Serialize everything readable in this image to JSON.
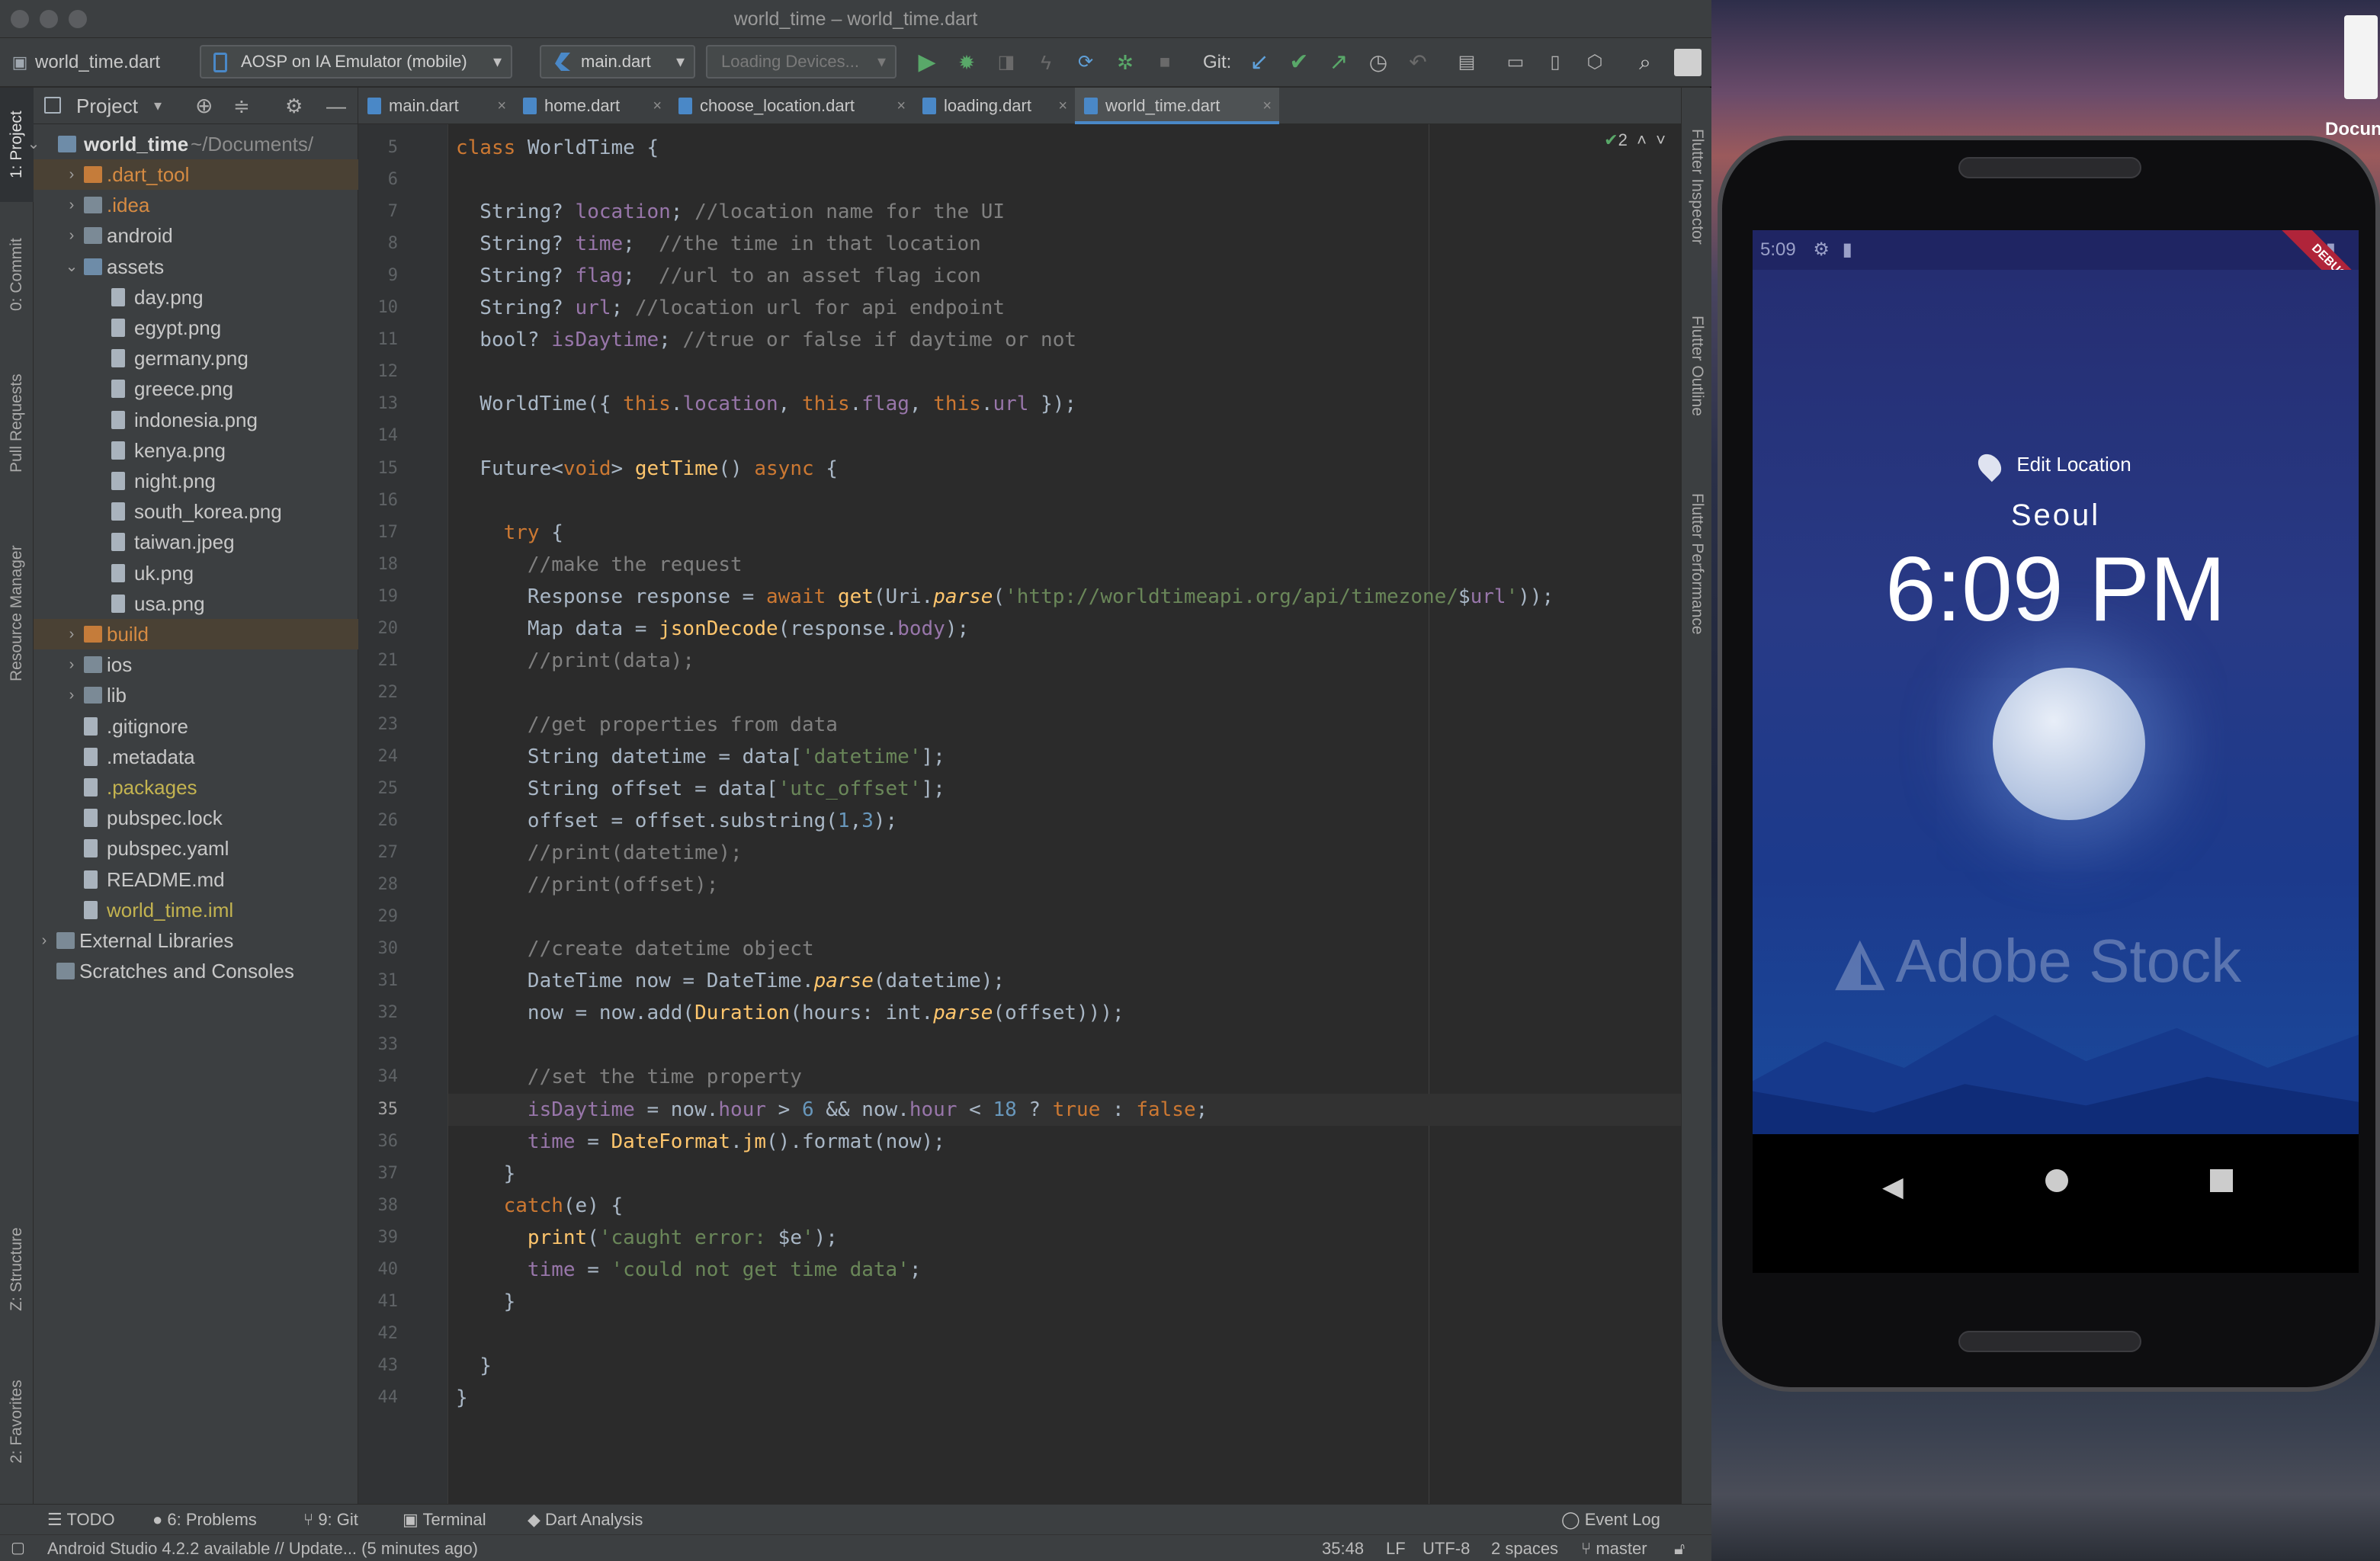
{
  "window": {
    "title": "world_time – world_time.dart"
  },
  "toolbar": {
    "project_name": "world_time.dart",
    "device": "AOSP on IA Emulator (mobile)",
    "run_config": "main.dart",
    "devices_loading": "Loading Devices...",
    "git_label": "Git:"
  },
  "left_stripe": {
    "project": "1: Project",
    "commit": "0: Commit",
    "pull_requests": "Pull Requests",
    "resource_manager": "Resource Manager",
    "structure": "Z: Structure",
    "favorites": "2: Favorites"
  },
  "project_panel": {
    "title": "Project",
    "root_name": "world_time",
    "root_path": "~/Documents/",
    "items": [
      {
        "label": "dart_tool",
        "display": ".dart_tool"
      },
      {
        "label": ".idea"
      },
      {
        "label": "android"
      },
      {
        "label": "assets"
      },
      {
        "label": "day.png"
      },
      {
        "label": "egypt.png"
      },
      {
        "label": "germany.png"
      },
      {
        "label": "greece.png"
      },
      {
        "label": "indonesia.png"
      },
      {
        "label": "kenya.png"
      },
      {
        "label": "night.png"
      },
      {
        "label": "south_korea.png"
      },
      {
        "label": "taiwan.jpeg"
      },
      {
        "label": "uk.png"
      },
      {
        "label": "usa.png"
      },
      {
        "label": "build"
      },
      {
        "label": "ios"
      },
      {
        "label": "lib"
      },
      {
        "label": ".gitignore"
      },
      {
        "label": ".metadata"
      },
      {
        "label": ".packages"
      },
      {
        "label": "pubspec.lock"
      },
      {
        "label": "pubspec.yaml"
      },
      {
        "label": "README.md"
      },
      {
        "label": "world_time.iml"
      },
      {
        "label": "External Libraries"
      },
      {
        "label": "Scratches and Consoles"
      }
    ]
  },
  "tabs": [
    "main.dart",
    "home.dart",
    "choose_location.dart",
    "loading.dart",
    "world_time.dart"
  ],
  "editor": {
    "inspection_count": "2",
    "line_numbers": [
      "5",
      "6",
      "7",
      "8",
      "9",
      "10",
      "11",
      "12",
      "13",
      "14",
      "15",
      "16",
      "17",
      "18",
      "19",
      "20",
      "21",
      "22",
      "23",
      "24",
      "25",
      "26",
      "27",
      "28",
      "29",
      "30",
      "31",
      "32",
      "33",
      "34",
      "35",
      "36",
      "37",
      "38",
      "39",
      "40",
      "41",
      "42",
      "43",
      "44"
    ],
    "current_line": "35"
  },
  "right_stripe": {
    "inspector": "Flutter Inspector",
    "outline": "Flutter Outline",
    "performance": "Flutter Performance"
  },
  "bottom_tools": {
    "todo": "TODO",
    "problems": "6: Problems",
    "git": "9: Git",
    "terminal": "Terminal",
    "dart_analysis": "Dart Analysis",
    "event_log": "Event Log"
  },
  "status": {
    "message": "Android Studio 4.2.2 available // Update... (5 minutes ago)",
    "position": "35:48",
    "line_sep": "LF",
    "encoding": "UTF-8",
    "indent": "2 spaces",
    "branch": "master"
  },
  "phone": {
    "status_time": "5:09",
    "debug": "DEBUG",
    "edit_location": "Edit Location",
    "city": "Seoul",
    "time": "6:09 PM",
    "watermark": "Adobe Stock"
  },
  "desktop": {
    "doc_label": "Docun"
  }
}
